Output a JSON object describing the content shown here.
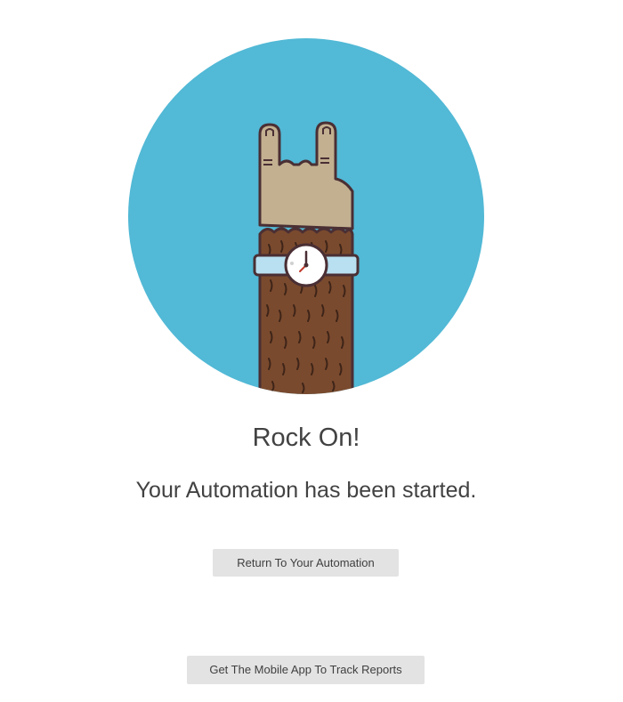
{
  "illustration": {
    "icon": "rock-on-hand-with-watch",
    "circle_color": "#52b9d6",
    "skin_color": "#c2b090",
    "fur_color": "#7a4a2e",
    "strap_color": "#b9e0f0",
    "outline_color": "#4a2f34"
  },
  "main": {
    "title": "Rock On!",
    "subtitle": "Your Automation has been started."
  },
  "buttons": {
    "return_label": "Return To Your Automation",
    "mobile_label": "Get The Mobile App To Track Reports"
  }
}
